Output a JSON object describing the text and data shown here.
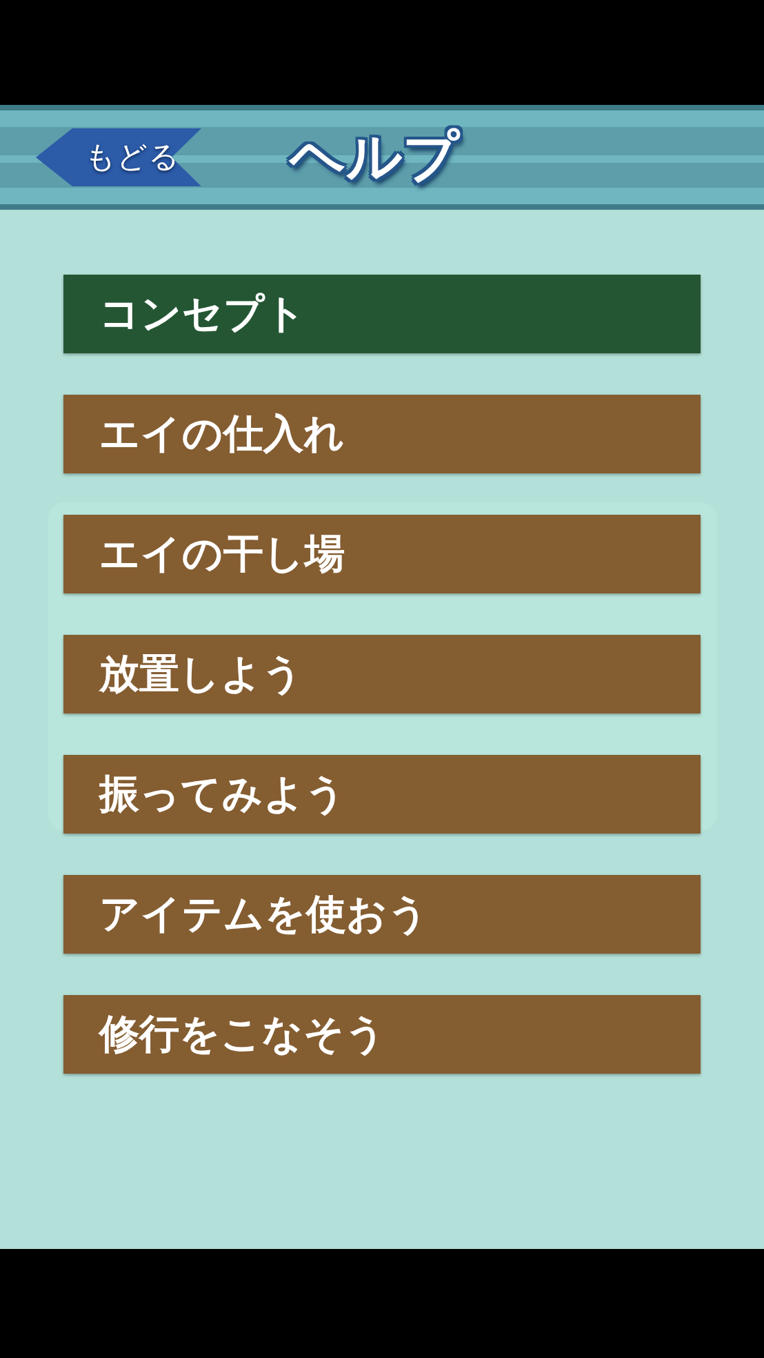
{
  "header": {
    "back_button": "もどる",
    "title": "ヘルプ"
  },
  "menu": [
    {
      "label": "コンセプト",
      "selected": true
    },
    {
      "label": "エイの仕入れ",
      "selected": false
    },
    {
      "label": "エイの干し場",
      "selected": false
    },
    {
      "label": "放置しよう",
      "selected": false
    },
    {
      "label": "振ってみよう",
      "selected": false
    },
    {
      "label": "アイテムを使おう",
      "selected": false
    },
    {
      "label": "修行をこなそう",
      "selected": false
    }
  ]
}
